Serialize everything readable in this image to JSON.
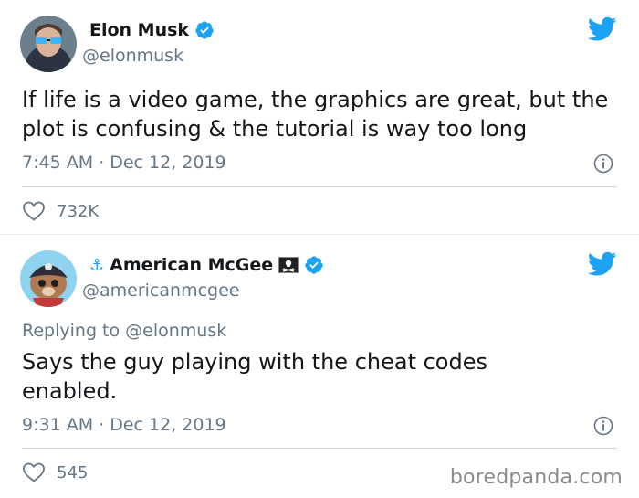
{
  "tweets": [
    {
      "name": "Elon Musk",
      "handle": "@elonmusk",
      "text": "If life is a video game, the graphics are great, but the plot is confusing & the tutorial is way too long",
      "time": "7:45 AM · Dec 12, 2019",
      "likes": "732K"
    },
    {
      "name": "American McGee",
      "name_prefix": "⚓",
      "name_suffix": "🏴‍☠️",
      "handle": "@americanmcgee",
      "replying_prefix": "Replying to ",
      "replying_to": "@elonmusk",
      "text": "Says the guy playing with the cheat codes enabled.",
      "time": "9:31 AM · Dec 12, 2019",
      "likes": "545"
    }
  ],
  "watermark": "boredpanda.com",
  "colors": {
    "accent": "#1da1f2",
    "secondary_text": "#657786",
    "divider": "#ccd6dd"
  },
  "icons": [
    "verified-badge-icon",
    "twitter-bird-icon",
    "info-icon",
    "heart-icon",
    "anchor-icon",
    "pirate-flag-icon"
  ]
}
